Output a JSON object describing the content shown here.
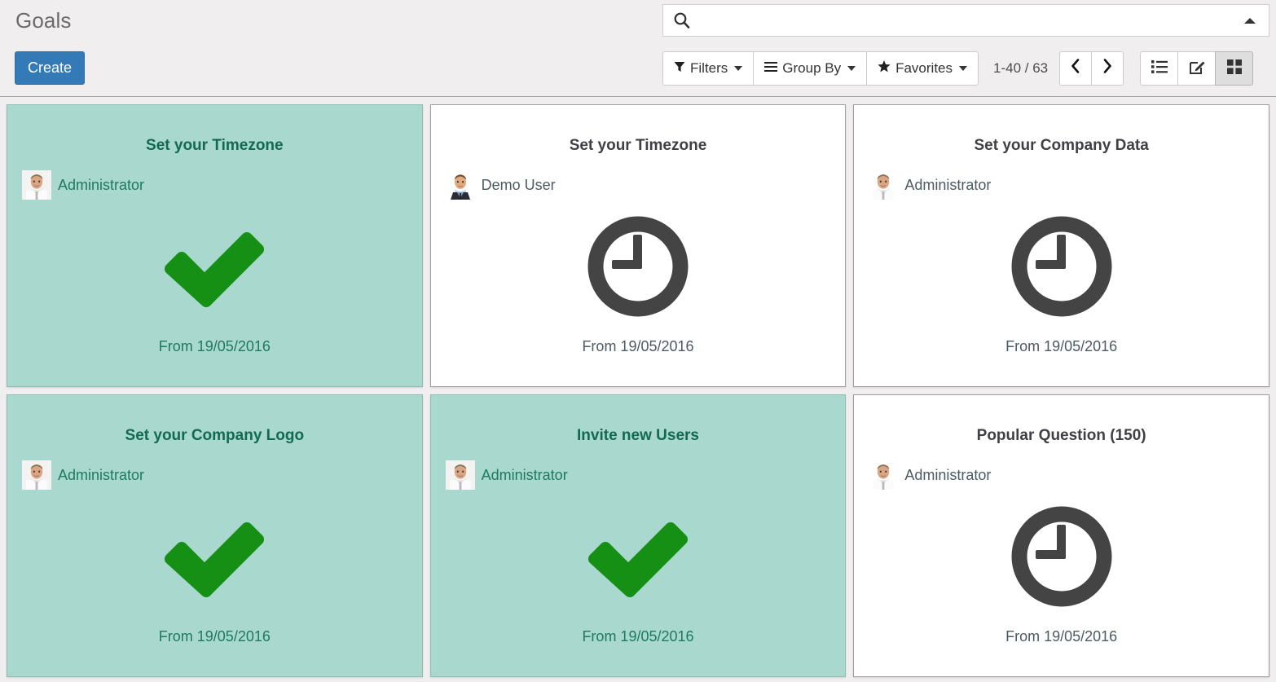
{
  "header": {
    "title": "Goals",
    "create_label": "Create"
  },
  "search": {
    "placeholder": "",
    "value": "",
    "icon": "search-icon",
    "toggle_icon": "caret-up-icon"
  },
  "toolbar": {
    "filters_label": "Filters",
    "filters_icon": "funnel-icon",
    "group_by_label": "Group By",
    "group_by_icon": "bars-icon",
    "favorites_label": "Favorites",
    "favorites_icon": "star-icon",
    "pager_value": "1-40 / 63",
    "prev_icon": "chevron-left-icon",
    "next_icon": "chevron-right-icon",
    "views": [
      {
        "name": "list",
        "icon": "list-view-icon",
        "active": false
      },
      {
        "name": "form",
        "icon": "form-view-icon",
        "active": false
      },
      {
        "name": "kanban",
        "icon": "kanban-view-icon",
        "active": true
      }
    ]
  },
  "colors": {
    "primary": "#337ab7",
    "reached_bg": "#a8d8ce",
    "reached_text": "#126a52",
    "check_green": "#159015",
    "clock_gray": "#444444",
    "page_bg": "#f0eeee"
  },
  "kanban": {
    "cards": [
      {
        "title": "Set your Timezone",
        "user": "Administrator",
        "avatar": "administrator-avatar",
        "status_icon": "check-icon",
        "date": "From 19/05/2016",
        "reached": true
      },
      {
        "title": "Set your Timezone",
        "user": "Demo User",
        "avatar": "demo-user-avatar",
        "status_icon": "clock-icon",
        "date": "From 19/05/2016",
        "reached": false
      },
      {
        "title": "Set your Company Data",
        "user": "Administrator",
        "avatar": "administrator-avatar",
        "status_icon": "clock-icon",
        "date": "From 19/05/2016",
        "reached": false
      },
      {
        "title": "Set your Company Logo",
        "user": "Administrator",
        "avatar": "administrator-avatar",
        "status_icon": "check-icon",
        "date": "From 19/05/2016",
        "reached": true
      },
      {
        "title": "Invite new Users",
        "user": "Administrator",
        "avatar": "administrator-avatar",
        "status_icon": "check-icon",
        "date": "From 19/05/2016",
        "reached": true
      },
      {
        "title": "Popular Question (150)",
        "user": "Administrator",
        "avatar": "administrator-avatar",
        "status_icon": "clock-icon",
        "date": "From 19/05/2016",
        "reached": false
      }
    ]
  }
}
